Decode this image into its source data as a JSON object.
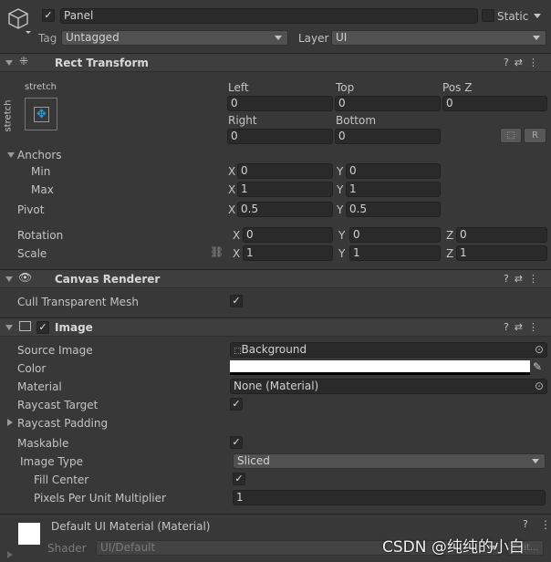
{
  "header": {
    "active": true,
    "name": "Panel",
    "static_label": "Static",
    "static": false,
    "tag_label": "Tag",
    "tag": "Untagged",
    "layer_label": "Layer",
    "layer": "UI"
  },
  "rect_transform": {
    "title": "Rect Transform",
    "anchor_preset_h": "stretch",
    "anchor_preset_v": "stretch",
    "left_label": "Left",
    "left": "0",
    "top_label": "Top",
    "top": "0",
    "posz_label": "Pos Z",
    "posz": "0",
    "right_label": "Right",
    "right": "0",
    "bottom_label": "Bottom",
    "bottom": "0",
    "r_button": "R",
    "anchors_label": "Anchors",
    "min_label": "Min",
    "min_x": "0",
    "min_y": "0",
    "max_label": "Max",
    "max_x": "1",
    "max_y": "1",
    "pivot_label": "Pivot",
    "pivot_x": "0.5",
    "pivot_y": "0.5",
    "rotation_label": "Rotation",
    "rot_x": "0",
    "rot_y": "0",
    "rot_z": "0",
    "scale_label": "Scale",
    "scale_x": "1",
    "scale_y": "1",
    "scale_z": "1",
    "x": "X",
    "y": "Y",
    "z": "Z"
  },
  "canvas_renderer": {
    "title": "Canvas Renderer",
    "cull_label": "Cull Transparent Mesh",
    "cull": true
  },
  "image": {
    "title": "Image",
    "enabled": true,
    "source_label": "Source Image",
    "source": "Background",
    "color_label": "Color",
    "color": "#ffffff",
    "material_label": "Material",
    "material": "None (Material)",
    "raycast_target_label": "Raycast Target",
    "raycast_target": true,
    "raycast_padding_label": "Raycast Padding",
    "maskable_label": "Maskable",
    "maskable": true,
    "image_type_label": "Image Type",
    "image_type": "Sliced",
    "fill_center_label": "Fill Center",
    "fill_center": true,
    "ppu_label": "Pixels Per Unit Multiplier",
    "ppu": "1"
  },
  "material": {
    "title": "Default UI Material (Material)",
    "shader_label": "Shader",
    "shader": "UI/Default",
    "edit_button": "Edit..."
  },
  "watermark": "CSDN @纯纯的小白"
}
